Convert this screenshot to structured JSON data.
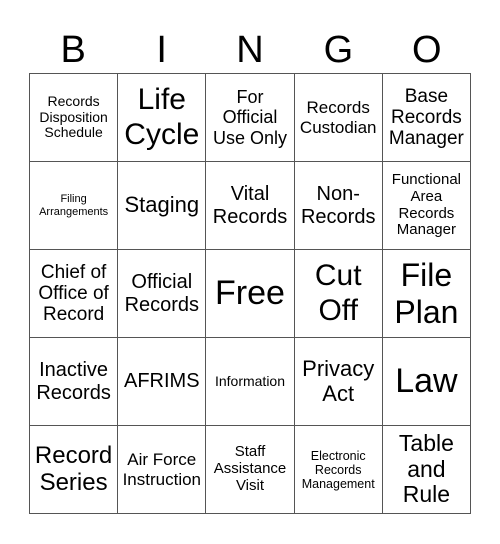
{
  "header": [
    "B",
    "I",
    "N",
    "G",
    "O"
  ],
  "rows": [
    [
      "Records Disposition Schedule",
      "Life Cycle",
      "For Official Use Only",
      "Records Custodian",
      "Base Records Manager"
    ],
    [
      "Filing Arrangements",
      "Staging",
      "Vital Records",
      "Non-Records",
      "Functional Area Records Manager"
    ],
    [
      "Chief of Office of Record",
      "Official Records",
      "Free",
      "Cut Off",
      "File Plan"
    ],
    [
      "Inactive Records",
      "AFRIMS",
      "Information",
      "Privacy Act",
      "Law"
    ],
    [
      "Record Series",
      "Air Force Instruction",
      "Staff Assistance Visit",
      "Electronic Records Management",
      "Table and Rule"
    ]
  ]
}
